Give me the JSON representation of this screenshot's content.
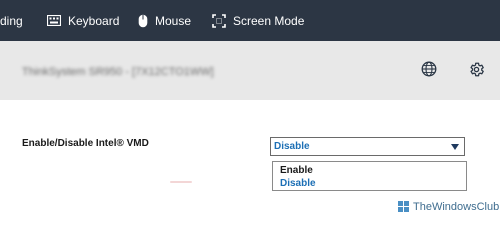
{
  "toolbar": {
    "items": [
      {
        "label": "ding",
        "icon": "tab-clipped-icon"
      },
      {
        "label": "Keyboard",
        "icon": "keyboard-icon"
      },
      {
        "label": "Mouse",
        "icon": "mouse-icon"
      },
      {
        "label": "Screen Mode",
        "icon": "fullscreen-icon"
      }
    ]
  },
  "header": {
    "title": "ThinkSystem SR950 - [7X12CTO1WW]",
    "globe_icon": "globe-icon",
    "settings_icon": "gear-icon"
  },
  "setting": {
    "label": "Enable/Disable Intel® VMD",
    "selected_value": "Disable",
    "options": [
      "Enable",
      "Disable"
    ]
  },
  "watermark": {
    "text": "TheWindowsClub"
  },
  "colors": {
    "toolbar_bg": "#2c3644",
    "header_bg": "#e8e8e8",
    "accent": "#1c6fb5"
  }
}
